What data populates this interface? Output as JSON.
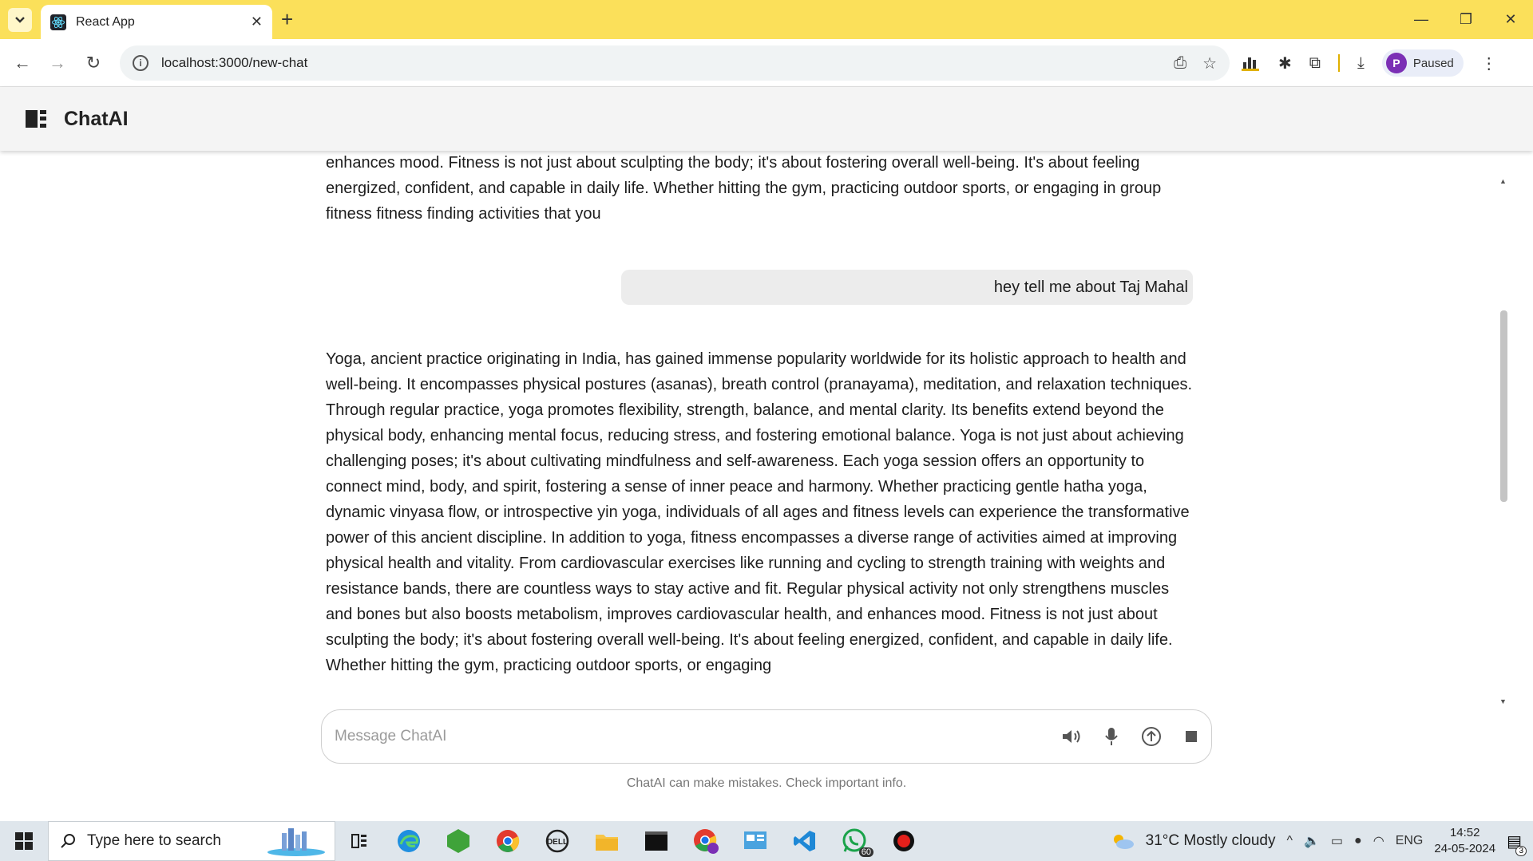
{
  "browser": {
    "tab_title": "React App",
    "url": "localhost:3000/new-chat",
    "profile_initial": "P",
    "profile_label": "Paused"
  },
  "app": {
    "brand": "ChatAI"
  },
  "chat": {
    "prev_response_tail": "physical activity not only strengthens muscles and bones but also boosts metabolism, improves cardiovascular health, and enhances mood. Fitness is not just about sculpting the body; it's about fostering overall well-being. It's about feeling energized, confident, and capable in daily life. Whether hitting the gym, practicing outdoor sports, or engaging in group fitness fitness finding activities that you",
    "user_message": "hey tell me about Taj Mahal",
    "assistant_response": "Yoga, ancient practice originating in India, has gained immense popularity worldwide for its holistic approach to health and well-being. It encompasses physical postures (asanas), breath control (pranayama), meditation, and relaxation techniques. Through regular practice, yoga promotes flexibility, strength, balance, and mental clarity. Its benefits extend beyond the physical body, enhancing mental focus, reducing stress, and fostering emotional balance. Yoga is not just about achieving challenging poses; it's about cultivating mindfulness and self-awareness. Each yoga session offers an opportunity to connect mind, body, and spirit, fostering a sense of inner peace and harmony. Whether practicing gentle hatha yoga, dynamic vinyasa flow, or introspective yin yoga, individuals of all ages and fitness levels can experience the transformative power of this ancient discipline. In addition to yoga, fitness encompasses a diverse range of activities aimed at improving physical health and vitality. From cardiovascular exercises like running and cycling to strength training with weights and resistance bands, there are countless ways to stay active and fit. Regular physical activity not only strengthens muscles and bones but also boosts metabolism, improves cardiovascular health, and enhances mood. Fitness is not just about sculpting the body; it's about fostering overall well-being. It's about feeling energized, confident, and capable in daily life. Whether hitting the gym, practicing outdoor sports, or engaging"
  },
  "composer": {
    "placeholder": "Message ChatAI",
    "disclaimer": "ChatAI can make mistakes. Check important info."
  },
  "taskbar": {
    "search_placeholder": "Type here to search",
    "whatsapp_badge": "60",
    "weather": "31°C  Mostly cloudy",
    "language": "ENG",
    "time": "14:52",
    "date": "24-05-2024",
    "notification_count": "3"
  }
}
